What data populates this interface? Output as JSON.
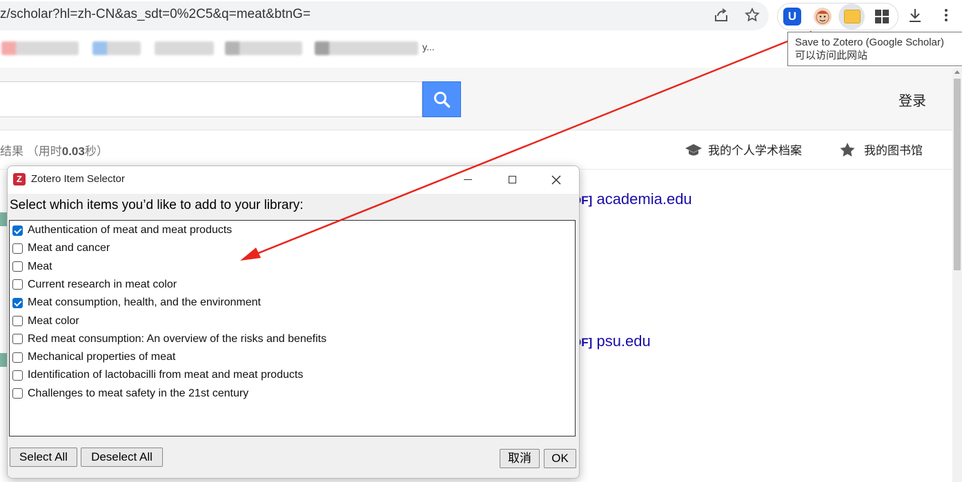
{
  "browser": {
    "url": "z/scholar?hl=zh-CN&as_sdt=0%2C5&q=meat&btnG=",
    "bitwarden_glyph": "U",
    "bookmark_tail": "y...",
    "icons": [
      "share-icon",
      "star-icon",
      "bitwarden-icon",
      "face-extension-icon",
      "zotero-folder-icon",
      "extensions-puzzle-icon",
      "download-icon",
      "kebab-menu-icon"
    ]
  },
  "tooltip": {
    "line1": "Save to Zotero (Google Scholar)",
    "line2": "可以访问此网站"
  },
  "scholar": {
    "login": "登录",
    "results_prefix": "结果 （用时",
    "results_time": "0.03",
    "results_suffix": "秒）",
    "profile_link": "我的个人学术档案",
    "library_link": "我的图书馆",
    "result1_tag": "DF]",
    "result1_source": "academia.edu",
    "result2_tag": "DF]",
    "result2_source": "psu.edu"
  },
  "dialog": {
    "logo": "Z",
    "title": "Zotero Item Selector",
    "prompt": "Select which items you’d like to add to your library:",
    "items": [
      {
        "label": "Authentication of meat and meat products",
        "checked": true
      },
      {
        "label": "Meat and cancer",
        "checked": false
      },
      {
        "label": "Meat",
        "checked": false
      },
      {
        "label": "Current research in meat color",
        "checked": false
      },
      {
        "label": "Meat consumption, health, and the environment",
        "checked": true
      },
      {
        "label": "Meat color",
        "checked": false
      },
      {
        "label": "Red meat consumption: An overview of the risks and benefits",
        "checked": false
      },
      {
        "label": "Mechanical properties of meat",
        "checked": false
      },
      {
        "label": "Identification of lactobacilli from meat and meat products",
        "checked": false
      },
      {
        "label": "Challenges to meat safety in the 21st century",
        "checked": false
      }
    ],
    "select_all": "Select All",
    "deselect_all": "Deselect All",
    "cancel": "取消",
    "ok": "OK"
  },
  "colors": {
    "accent_blue": "#4d90fe",
    "checkbox_blue": "#0a6ed1",
    "annotation_arrow": "#e8261c",
    "link": "#1a0dab"
  }
}
